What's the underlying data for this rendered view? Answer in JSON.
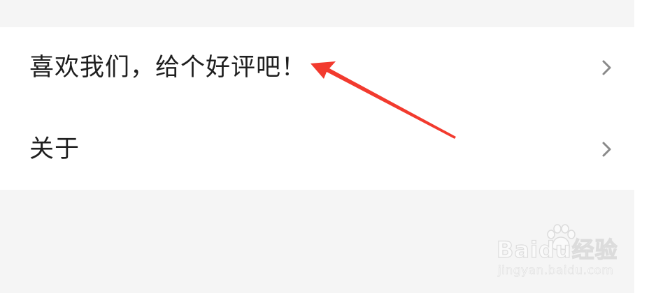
{
  "settings": {
    "items": [
      {
        "label": "喜欢我们，给个好评吧！",
        "icon": "chevron-right-icon"
      },
      {
        "label": "关于",
        "icon": "chevron-right-icon"
      }
    ]
  },
  "annotation": {
    "color": "#f23a2e",
    "icon": "red-arrow-icon"
  },
  "watermark": {
    "logo_text": "Baidu经验",
    "url": "jingyan.baidu.com"
  },
  "colors": {
    "background": "#f5f5f5",
    "row_background": "#ffffff",
    "text": "#1f1f1f",
    "chevron": "#8a8a8a"
  }
}
